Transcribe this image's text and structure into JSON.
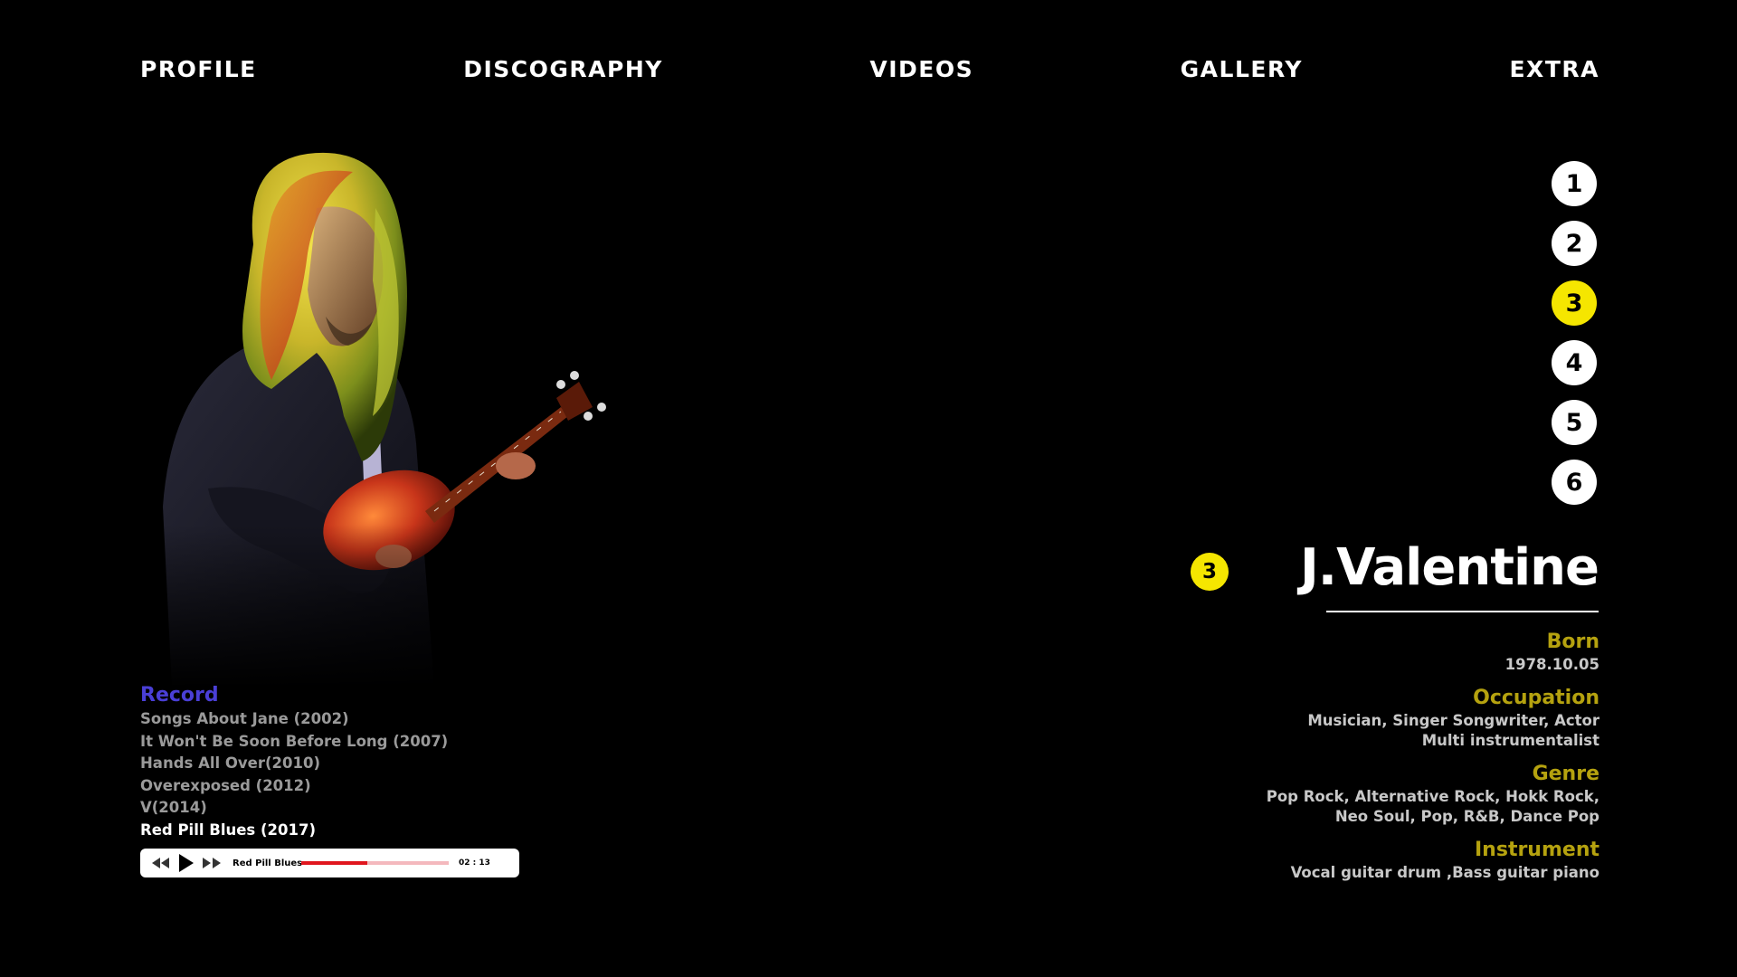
{
  "nav": {
    "items": [
      "PROFILE",
      "DISCOGRAPHY",
      "VIDEOS",
      "GALLERY",
      "EXTRA"
    ]
  },
  "selector": {
    "items": [
      "1",
      "2",
      "3",
      "4",
      "5",
      "6"
    ],
    "active": "3"
  },
  "profile": {
    "badge": "3",
    "name": "J.Valentine",
    "born_label": "Born",
    "born_value": "1978.10.05",
    "occupation_label": "Occupation",
    "occupation_line1": "Musician, Singer Songwriter, Actor",
    "occupation_line2": "Multi instrumentalist",
    "genre_label": "Genre",
    "genre_line1": "Pop Rock, Alternative Rock, Hokk Rock,",
    "genre_line2": "Neo Soul, Pop, R&B, Dance Pop",
    "instrument_label": "Instrument",
    "instrument_value": "Vocal guitar drum ,Bass guitar piano"
  },
  "record": {
    "title": "Record",
    "albums": [
      "Songs About Jane (2002)",
      "It Won't Be Soon Before Long (2007)",
      "Hands All Over(2010)",
      "Overexposed (2012)",
      "V(2014)",
      "Red Pill Blues (2017)"
    ],
    "current_index": 5
  },
  "player": {
    "track": "Red Pill Blues",
    "time": "02 : 13",
    "progress": 0.45,
    "icons": [
      "rewind-icon",
      "play-icon",
      "fast-forward-icon"
    ]
  },
  "colors": {
    "accent_yellow": "#f5e600",
    "label_olive": "#b5a20f",
    "record_blue": "#4a3fd6",
    "progress_red": "#e0161e",
    "progress_track": "#f4b8bd"
  }
}
